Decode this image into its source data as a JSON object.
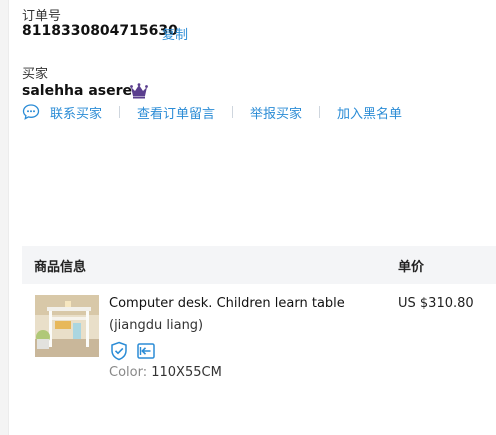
{
  "order": {
    "number_label": "订单号",
    "number_value": "8118330804715630",
    "copy_label": "复制"
  },
  "buyer": {
    "label": "买家",
    "name": "salehha asere",
    "actions": [
      "联系买家",
      "查看订单留言",
      "举报买家",
      "加入黑名单"
    ]
  },
  "table": {
    "col_product": "商品信息",
    "col_price": "单价"
  },
  "product": {
    "title": "Computer desk. Children learn table",
    "shop": "(jiangdu liang)",
    "sku_key": "Color:",
    "sku_value": "110X55CM",
    "price": "US $310.80"
  },
  "colors": {
    "link": "#2b8cd6",
    "crown": "#5a3e8e",
    "badge": "#2b8cd6",
    "header_bg": "#f4f5f7"
  }
}
